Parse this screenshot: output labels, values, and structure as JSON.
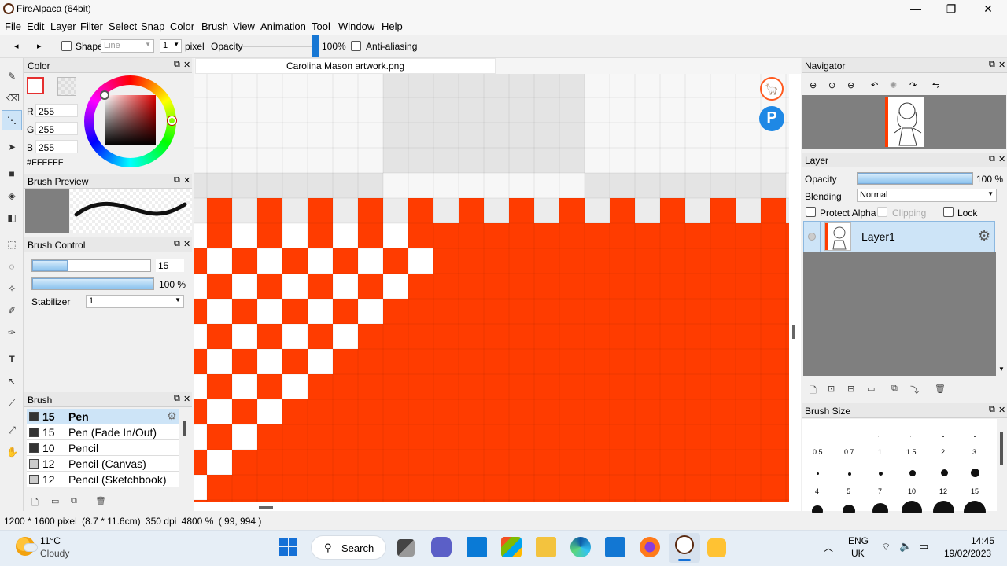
{
  "window": {
    "title": "FireAlpaca (64bit)",
    "minimize": "—",
    "maximize": "❐",
    "close": "✕"
  },
  "menu": [
    "File",
    "Edit",
    "Layer",
    "Filter",
    "Select",
    "Snap",
    "Color",
    "Brush",
    "View",
    "Animation",
    "Tool",
    "Window",
    "Help"
  ],
  "toolbar": {
    "undo": "◂",
    "redo": "▸",
    "shape_label": "Shape",
    "shape_value": "Line",
    "size_value": "1",
    "unit": "pixel",
    "opacity_label": "Opacity",
    "opacity_value": "100%",
    "opacity_fraction": 1.0,
    "antialias_label": "Anti-aliasing"
  },
  "color_panel": {
    "title": "Color",
    "r_label": "R",
    "r_value": "255",
    "g_label": "G",
    "g_value": "255",
    "b_label": "B",
    "b_value": "255",
    "hex": "#FFFFFF"
  },
  "brush_preview": {
    "title": "Brush Preview"
  },
  "brush_control": {
    "title": "Brush Control",
    "size_value": "15",
    "size_fraction": 0.3,
    "opacity_value": "100 %",
    "opacity_fraction": 1.0,
    "stabilizer_label": "Stabilizer",
    "stabilizer_value": "1"
  },
  "brush_panel": {
    "title": "Brush",
    "items": [
      {
        "size": "15",
        "name": "Pen",
        "selected": true,
        "color": "#333333"
      },
      {
        "size": "15",
        "name": "Pen (Fade In/Out)",
        "selected": false,
        "color": "#333333"
      },
      {
        "size": "10",
        "name": "Pencil",
        "selected": false,
        "color": "#333333"
      },
      {
        "size": "12",
        "name": "Pencil (Canvas)",
        "selected": false,
        "color": "#cccccc"
      },
      {
        "size": "12",
        "name": "Pencil (Sketchbook)",
        "selected": false,
        "color": "#cccccc"
      }
    ]
  },
  "canvas": {
    "tab": "Carolina Mason artwork.png",
    "fill_color": "#ff3c00"
  },
  "navigator": {
    "title": "Navigator"
  },
  "layer_panel": {
    "title": "Layer",
    "opacity_label": "Opacity",
    "opacity_value": "100 %",
    "opacity_fraction": 1.0,
    "blending_label": "Blending",
    "blending_value": "Normal",
    "protect_alpha": "Protect Alpha",
    "clipping": "Clipping",
    "lock": "Lock",
    "layer_name": "Layer1"
  },
  "brush_size": {
    "title": "Brush Size",
    "row1": [
      "0.5",
      "0.7",
      "1",
      "1.5",
      "2",
      "3"
    ],
    "row2": [
      "4",
      "5",
      "7",
      "10",
      "12",
      "15"
    ]
  },
  "status": {
    "dims": "1200 * 1600 pixel",
    "physical": "(8.7 * 11.6cm)",
    "dpi": "350 dpi",
    "zoom": "4800 %",
    "coords": "( 99, 994 )"
  },
  "taskbar": {
    "temp": "11°C",
    "weather": "Cloudy",
    "search": "Search",
    "lang1": "ENG",
    "lang2": "UK",
    "time": "14:45",
    "date": "19/02/2023"
  }
}
